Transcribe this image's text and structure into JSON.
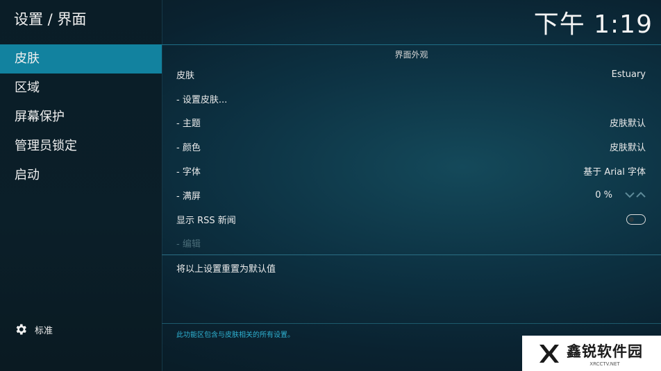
{
  "header": {
    "title": "设置 / 界面",
    "clock": "下午 1:19"
  },
  "sidebar": {
    "items": [
      {
        "label": "皮肤"
      },
      {
        "label": "区域"
      },
      {
        "label": "屏幕保护"
      },
      {
        "label": "管理员锁定"
      },
      {
        "label": "启动"
      }
    ],
    "level_label": "标准"
  },
  "main": {
    "section_title": "界面外观",
    "rows": [
      {
        "label": "皮肤",
        "value": "Estuary"
      },
      {
        "label": "- 设置皮肤...",
        "value": ""
      },
      {
        "label": "- 主题",
        "value": "皮肤默认"
      },
      {
        "label": "- 颜色",
        "value": "皮肤默认"
      },
      {
        "label": "- 字体",
        "value": "基于 Arial 字体"
      },
      {
        "label": "- 满屏",
        "value": "0 %"
      },
      {
        "label": "显示 RSS 新闻",
        "value": ""
      },
      {
        "label": "- 编辑",
        "value": ""
      }
    ],
    "rss_enabled": false,
    "reset_label": "将以上设置重置为默认值",
    "help_text": "此功能区包含与皮肤相关的所有设置。"
  },
  "watermark": {
    "title": "鑫锐软件园",
    "subtitle": "XRCCTV.NET"
  },
  "colors": {
    "accent": "#12829f",
    "help": "#2fb0d0"
  },
  "icons": {
    "level": "gear-icon",
    "zoom_down": "chevron-down-icon",
    "zoom_up": "chevron-up-icon"
  }
}
